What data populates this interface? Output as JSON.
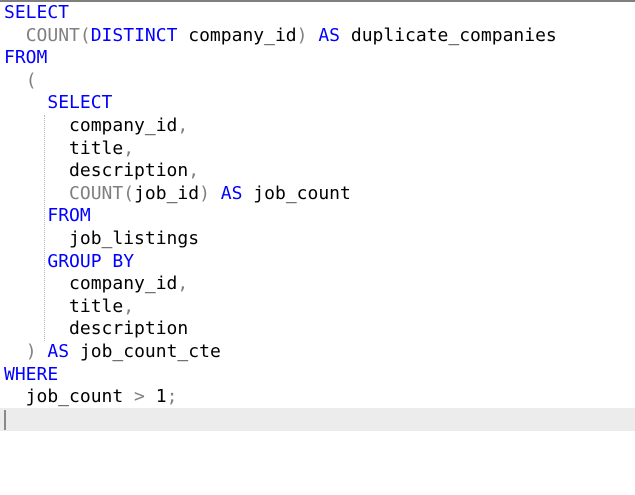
{
  "sql": {
    "lines": [
      {
        "tokens": [
          {
            "t": "SELECT",
            "c": "kw"
          }
        ]
      },
      {
        "tokens": [
          {
            "t": "  "
          },
          {
            "t": "COUNT",
            "c": "op"
          },
          {
            "t": "(",
            "c": "op"
          },
          {
            "t": "DISTINCT",
            "c": "kw"
          },
          {
            "t": " company_id"
          },
          {
            "t": ")",
            "c": "op"
          },
          {
            "t": " "
          },
          {
            "t": "AS",
            "c": "kw"
          },
          {
            "t": " duplicate_companies"
          }
        ]
      },
      {
        "tokens": [
          {
            "t": "FROM",
            "c": "kw"
          }
        ]
      },
      {
        "tokens": [
          {
            "t": "  "
          },
          {
            "t": "(",
            "c": "op"
          }
        ]
      },
      {
        "tokens": [
          {
            "t": "    "
          },
          {
            "t": "SELECT",
            "c": "kw"
          }
        ]
      },
      {
        "tokens": [
          {
            "t": "      company_id"
          },
          {
            "t": ",",
            "c": "op"
          }
        ]
      },
      {
        "tokens": [
          {
            "t": "      title"
          },
          {
            "t": ",",
            "c": "op"
          }
        ]
      },
      {
        "tokens": [
          {
            "t": "      description"
          },
          {
            "t": ",",
            "c": "op"
          }
        ]
      },
      {
        "tokens": [
          {
            "t": "      "
          },
          {
            "t": "COUNT",
            "c": "op"
          },
          {
            "t": "(",
            "c": "op"
          },
          {
            "t": "job_id"
          },
          {
            "t": ")",
            "c": "op"
          },
          {
            "t": " "
          },
          {
            "t": "AS",
            "c": "kw"
          },
          {
            "t": " job_count"
          }
        ]
      },
      {
        "tokens": [
          {
            "t": "    "
          },
          {
            "t": "FROM",
            "c": "kw"
          }
        ]
      },
      {
        "tokens": [
          {
            "t": "      job_listings"
          }
        ]
      },
      {
        "tokens": [
          {
            "t": "    "
          },
          {
            "t": "GROUP BY",
            "c": "kw"
          }
        ]
      },
      {
        "tokens": [
          {
            "t": "      company_id"
          },
          {
            "t": ",",
            "c": "op"
          }
        ]
      },
      {
        "tokens": [
          {
            "t": "      title"
          },
          {
            "t": ",",
            "c": "op"
          }
        ]
      },
      {
        "tokens": [
          {
            "t": "      description"
          }
        ]
      },
      {
        "tokens": [
          {
            "t": "  "
          },
          {
            "t": ")",
            "c": "op"
          },
          {
            "t": " "
          },
          {
            "t": "AS",
            "c": "kw"
          },
          {
            "t": " job_count_cte"
          }
        ]
      },
      {
        "tokens": [
          {
            "t": "WHERE",
            "c": "kw"
          }
        ]
      },
      {
        "tokens": [
          {
            "t": "  job_count "
          },
          {
            "t": ">",
            "c": "op"
          },
          {
            "t": " "
          },
          {
            "t": "1",
            "c": "num"
          },
          {
            "t": ";",
            "c": "op"
          }
        ]
      }
    ]
  },
  "colors": {
    "keyword": "#0000ff",
    "operator": "#808080",
    "text": "#000000",
    "current_line": "#ececec"
  }
}
